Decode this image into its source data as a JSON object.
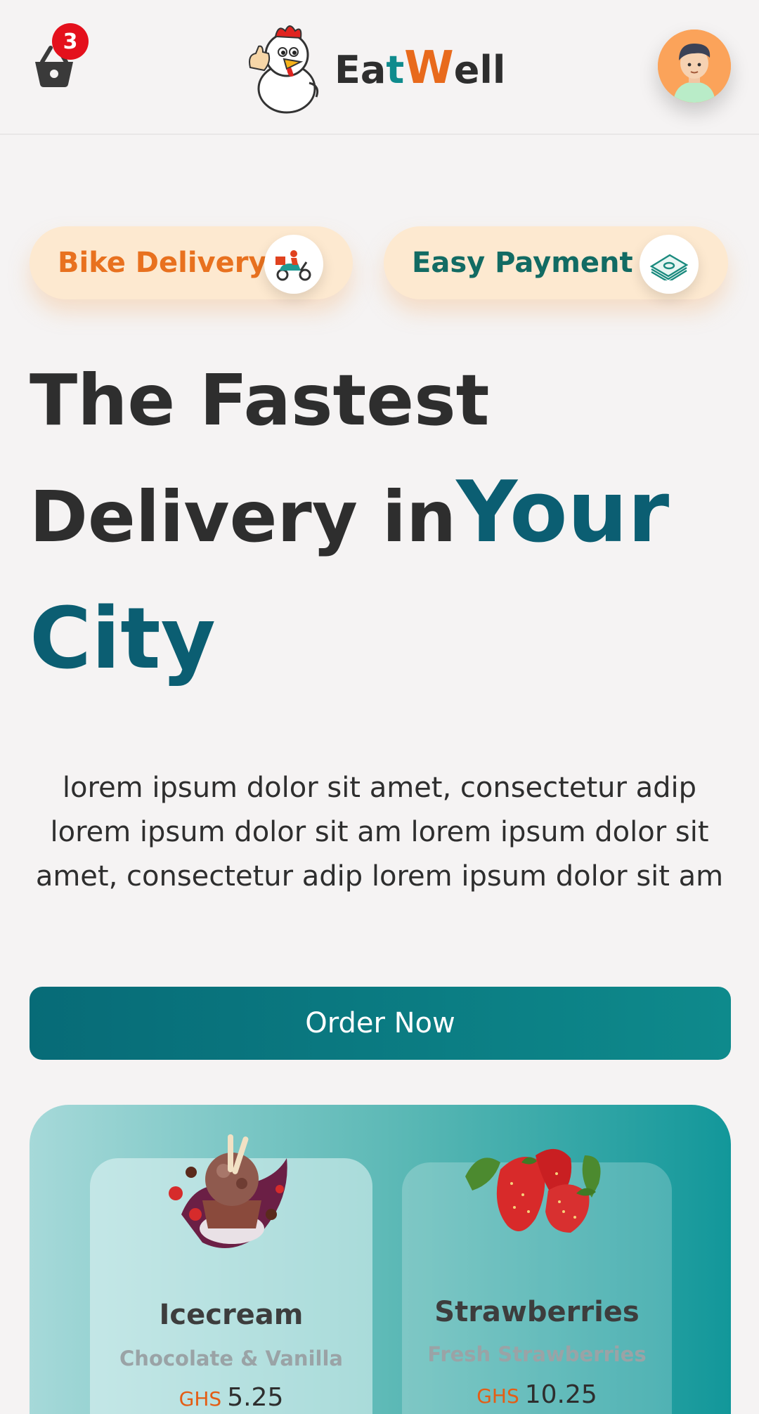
{
  "header": {
    "cart_count": "3",
    "brand": {
      "part1": "Ea",
      "part2": "t",
      "part3": "W",
      "part4": "ell"
    }
  },
  "features": [
    {
      "label": "Bike Delivery",
      "icon": "scooter-icon"
    },
    {
      "label": "Easy Payment",
      "icon": "cash-icon"
    }
  ],
  "hero": {
    "line1": "The Fastest",
    "line2": "Delivery in",
    "accent1": "Your",
    "accent2": "City"
  },
  "description": "lorem ipsum dolor sit amet, consectetur adip lorem ipsum dolor sit am lorem ipsum dolor sit amet, consectetur adip lorem ipsum dolor sit am",
  "order_button": "Order Now",
  "products": [
    {
      "name": "Icecream",
      "subtitle": "Chocolate & Vanilla",
      "currency": "GHS",
      "price": "5.25"
    },
    {
      "name": "Strawberries",
      "subtitle": "Fresh Strawberries",
      "currency": "GHS",
      "price": "10.25"
    }
  ],
  "colors": {
    "background": "#f5f3f3",
    "accent_teal": "#0b5e72",
    "brand_orange": "#e86a1c",
    "button": "#0e8a8c",
    "badge": "#e4101c"
  }
}
